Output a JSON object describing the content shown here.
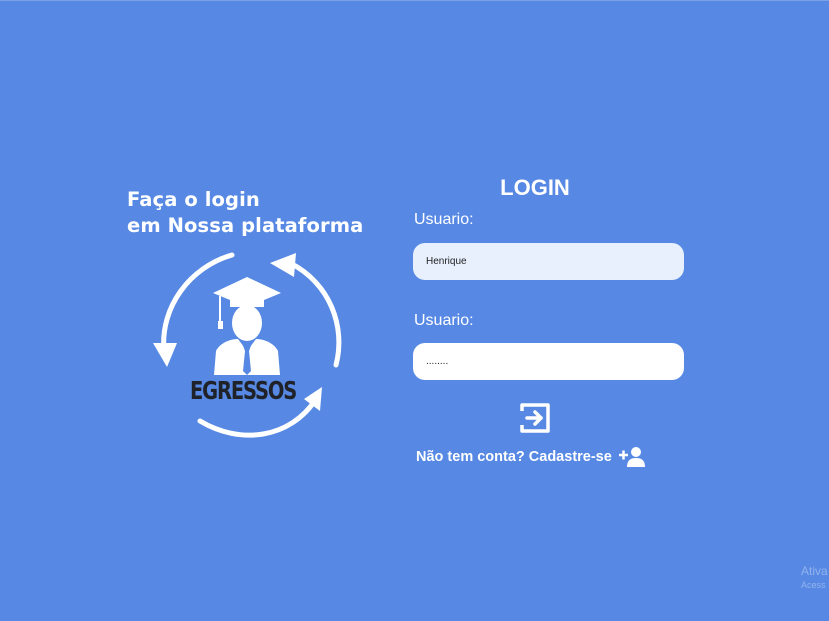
{
  "hero": {
    "tagline_line1": "Faça o login",
    "tagline_line2": "em Nossa plataforma",
    "logo_text": "EGRESSOS",
    "logo_icon": "graduate-cycle-icon"
  },
  "login": {
    "title": "LOGIN",
    "username_label": "Usuario:",
    "username_value": "Henrique",
    "password_label": "Usuario:",
    "password_value": "........",
    "submit_icon": "sign-in-icon",
    "signup_text": "Não tem conta? Cadastre-se",
    "signup_icon": "user-plus-icon"
  },
  "watermark": {
    "line1": "Ativa",
    "line2": "Acess"
  },
  "colors": {
    "background": "#5789e4",
    "text": "#ffffff",
    "autofill_input": "#e8f0fe",
    "logo_text": "#1f2329"
  }
}
